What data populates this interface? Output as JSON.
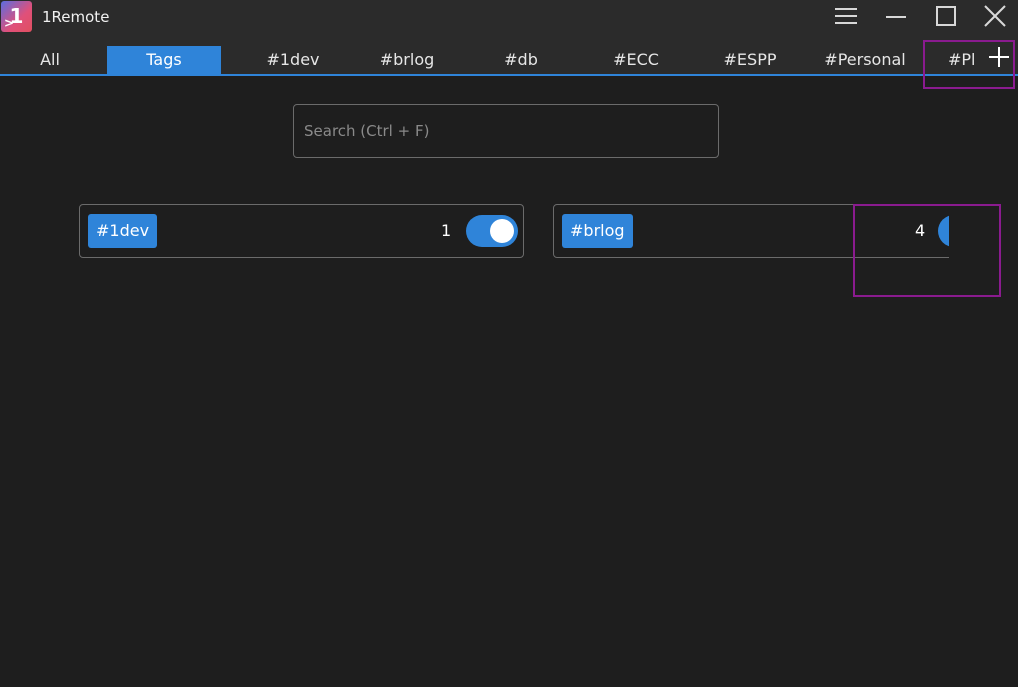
{
  "app": {
    "title": "1Remote",
    "logo_text": "1",
    "logo_prefix": ">"
  },
  "tabs": [
    {
      "label": "All",
      "active": false
    },
    {
      "label": "Tags",
      "active": true
    },
    {
      "label": "#1dev",
      "active": false
    },
    {
      "label": "#brlog",
      "active": false
    },
    {
      "label": "#db",
      "active": false
    },
    {
      "label": "#ECC",
      "active": false
    },
    {
      "label": "#ESPP",
      "active": false
    },
    {
      "label": "#Personal",
      "active": false
    },
    {
      "label": "#Pl",
      "active": false
    }
  ],
  "search": {
    "placeholder": "Search (Ctrl + F)",
    "value": ""
  },
  "tag_cards": [
    {
      "tag": "#1dev",
      "count": "1",
      "enabled": true
    },
    {
      "tag": "#brlog",
      "count": "4",
      "enabled": true
    }
  ],
  "colors": {
    "accent": "#2f84d9",
    "background": "#1e1e1e",
    "titlebar": "#2b2b2b",
    "highlight": "#8a1b8f"
  },
  "icons": {
    "menu": "hamburger-menu-icon",
    "minimize": "minimize-icon",
    "maximize": "maximize-icon",
    "close": "close-icon",
    "add": "plus-icon"
  }
}
